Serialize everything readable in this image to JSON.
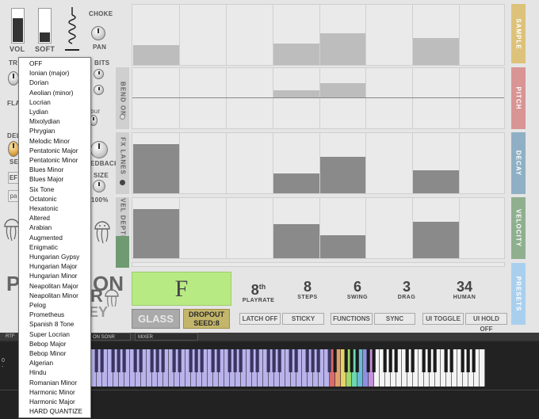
{
  "controls": {
    "vol_label": "VOL",
    "soft_label": "SOFT",
    "choke_label": "CHOKE",
    "pan_label": "PAN",
    "bits_label": "BITS",
    "feedback_label": "EDBACK",
    "size_label": "SIZE",
    "size_value": "100%",
    "ef_label": "EF",
    "pa_label": "pa",
    "partial_labels": [
      "TR",
      "FLA",
      "DEL",
      "SE",
      "bur"
    ]
  },
  "logo": {
    "line1": "P",
    "line1b": "ON",
    "line2": "R",
    "line3": "EY"
  },
  "lanes": [
    {
      "side_label": "SAMPLE",
      "side_color": "#dcc27a",
      "head_label": "",
      "values": [
        0.33,
        0,
        0,
        0.36,
        0.52,
        0,
        0.45,
        0
      ]
    },
    {
      "side_label": "PITCH",
      "side_color": "#d99494",
      "head_label": "BEND ON",
      "values": [
        0,
        0,
        0,
        0.2,
        0.4,
        0,
        0,
        0
      ]
    },
    {
      "side_label": "DECAY",
      "side_color": "#8fb0c4",
      "head_label": "FX LANES",
      "values": [
        0.82,
        0,
        0,
        0.33,
        0.6,
        0,
        0.38,
        0
      ]
    },
    {
      "side_label": "VELOCITY",
      "side_color": "#8fb08f",
      "head_label": "VEL DEPTH",
      "values": [
        0.82,
        0,
        0,
        0.56,
        0.38,
        0,
        0.6,
        0
      ]
    }
  ],
  "presets_label": "PRESETS",
  "presets_color": "#a9cfee",
  "note_display": "F",
  "glass_label": "GLASS",
  "dropout": {
    "line1": "DROPOUT",
    "line2": "SEED:8"
  },
  "stats": [
    {
      "num": "8",
      "sup": "th",
      "cap": "PLAYRATE"
    },
    {
      "num": "8",
      "sup": "",
      "cap": "STEPS"
    },
    {
      "num": "6",
      "sup": "",
      "cap": "SWING"
    },
    {
      "num": "3",
      "sup": "",
      "cap": "DRAG"
    },
    {
      "num": "34",
      "sup": "",
      "cap": "HUMAN"
    }
  ],
  "buttons": {
    "latch_off": "LATCH OFF",
    "sticky": "STICKY",
    "functions": "FUNCTIONS",
    "sync": "SYNC",
    "ui_toggle": "UI TOGGLE",
    "ui_hold_off": "UI HOLD OFF"
  },
  "tabs": {
    "rtf": "RTF",
    "on_sonr": "ON SONR",
    "mixer": "MIXER"
  },
  "menu_items": [
    "OFF",
    "Ionian (major)",
    "Dorian",
    "Aeolian (minor)",
    "Locrian",
    "Lydian",
    "Mixolydian",
    "Phrygian",
    "Melodic Minor",
    "Pentatonic Major",
    "Pentatonic Minor",
    "Blues Minor",
    "Blues Major",
    "Six Tone",
    "Octatonic",
    "Hexatonic",
    "Altered",
    "Arabian",
    "Augmented",
    "Enigmatic",
    "Hungarian Gypsy",
    "Hungarian Major",
    "Hungarian Minor",
    "Neapolitan Major",
    "Neapolitan Minor",
    "Pelog",
    "Prometheus",
    "Spanish 8 Tone",
    "Super Locrian",
    "Bebop Major",
    "Bebop Minor",
    "Algerian",
    "Hindu",
    "Romanian Minor",
    "Harmonic Minor",
    "Harmonic Major",
    "HARD QUANTIZE"
  ],
  "keyboard_labels": {
    "a": "0",
    "b": "-"
  }
}
